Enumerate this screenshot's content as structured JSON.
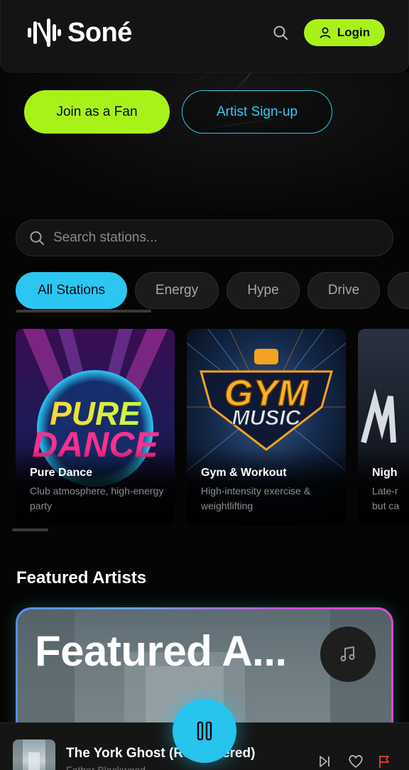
{
  "header": {
    "brand": "Soné",
    "login_label": "Login"
  },
  "hero": {
    "join_label": "Join as a Fan",
    "artist_label": "Artist Sign-up"
  },
  "search": {
    "placeholder": "Search stations..."
  },
  "filters": [
    {
      "label": "All Stations",
      "active": true
    },
    {
      "label": "Energy",
      "active": false
    },
    {
      "label": "Hype",
      "active": false
    },
    {
      "label": "Drive",
      "active": false
    }
  ],
  "stations": [
    {
      "title": "Pure Dance",
      "description": "Club atmosphere, high-energy party",
      "art_text_1": "PURE",
      "art_text_2": "DANCE"
    },
    {
      "title": "Gym & Workout",
      "description": "High-intensity exercise & weightlifting",
      "art_text_1": "GYM",
      "art_text_2": "MUSIC"
    },
    {
      "title": "Nigh",
      "description": "Late-r but ca"
    }
  ],
  "featured": {
    "section_title": "Featured Artists",
    "card_title": "Featured A..."
  },
  "player": {
    "track_title": "The York Ghost (Remastered)",
    "artist": "Father Blackwood"
  },
  "colors": {
    "accent_green": "#a8f21a",
    "accent_cyan": "#2cc6f3",
    "background": "#050505"
  }
}
